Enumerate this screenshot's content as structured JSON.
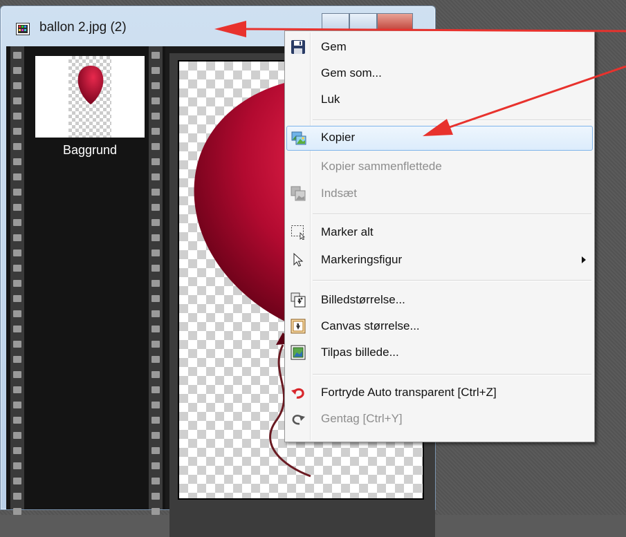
{
  "window": {
    "title": "ballon 2.jpg (2)"
  },
  "layers": {
    "items": [
      {
        "label": "Baggrund"
      }
    ]
  },
  "context_menu": {
    "items": [
      {
        "label": "Gem",
        "icon": "floppy-disk-icon",
        "enabled": true
      },
      {
        "label": "Gem som...",
        "enabled": true
      },
      {
        "label": "Luk",
        "enabled": true
      },
      {
        "label": "Kopier",
        "icon": "copy-image-icon",
        "enabled": true,
        "highlighted": true
      },
      {
        "label": "Kopier sammenflettede",
        "enabled": false
      },
      {
        "label": "Indsæt",
        "icon": "paste-image-icon",
        "enabled": false
      },
      {
        "label": "Marker alt",
        "icon": "select-all-icon",
        "enabled": true
      },
      {
        "label": "Markeringsfigur",
        "icon": "cursor-arrow-icon",
        "enabled": true,
        "submenu": true
      },
      {
        "label": "Billedstørrelse...",
        "icon": "image-size-icon",
        "enabled": true
      },
      {
        "label": "Canvas størrelse...",
        "icon": "canvas-size-icon",
        "enabled": true
      },
      {
        "label": "Tilpas billede...",
        "icon": "fit-image-icon",
        "enabled": true
      },
      {
        "label": "Fortryde Auto transparent [Ctrl+Z]",
        "icon": "undo-icon",
        "enabled": true
      },
      {
        "label": "Gentag [Ctrl+Y]",
        "icon": "redo-icon",
        "enabled": false
      }
    ]
  },
  "colors": {
    "annotation_arrow": "#e8322d",
    "balloon": "#b0102f",
    "menu_highlight_border": "#7eb4ea"
  }
}
